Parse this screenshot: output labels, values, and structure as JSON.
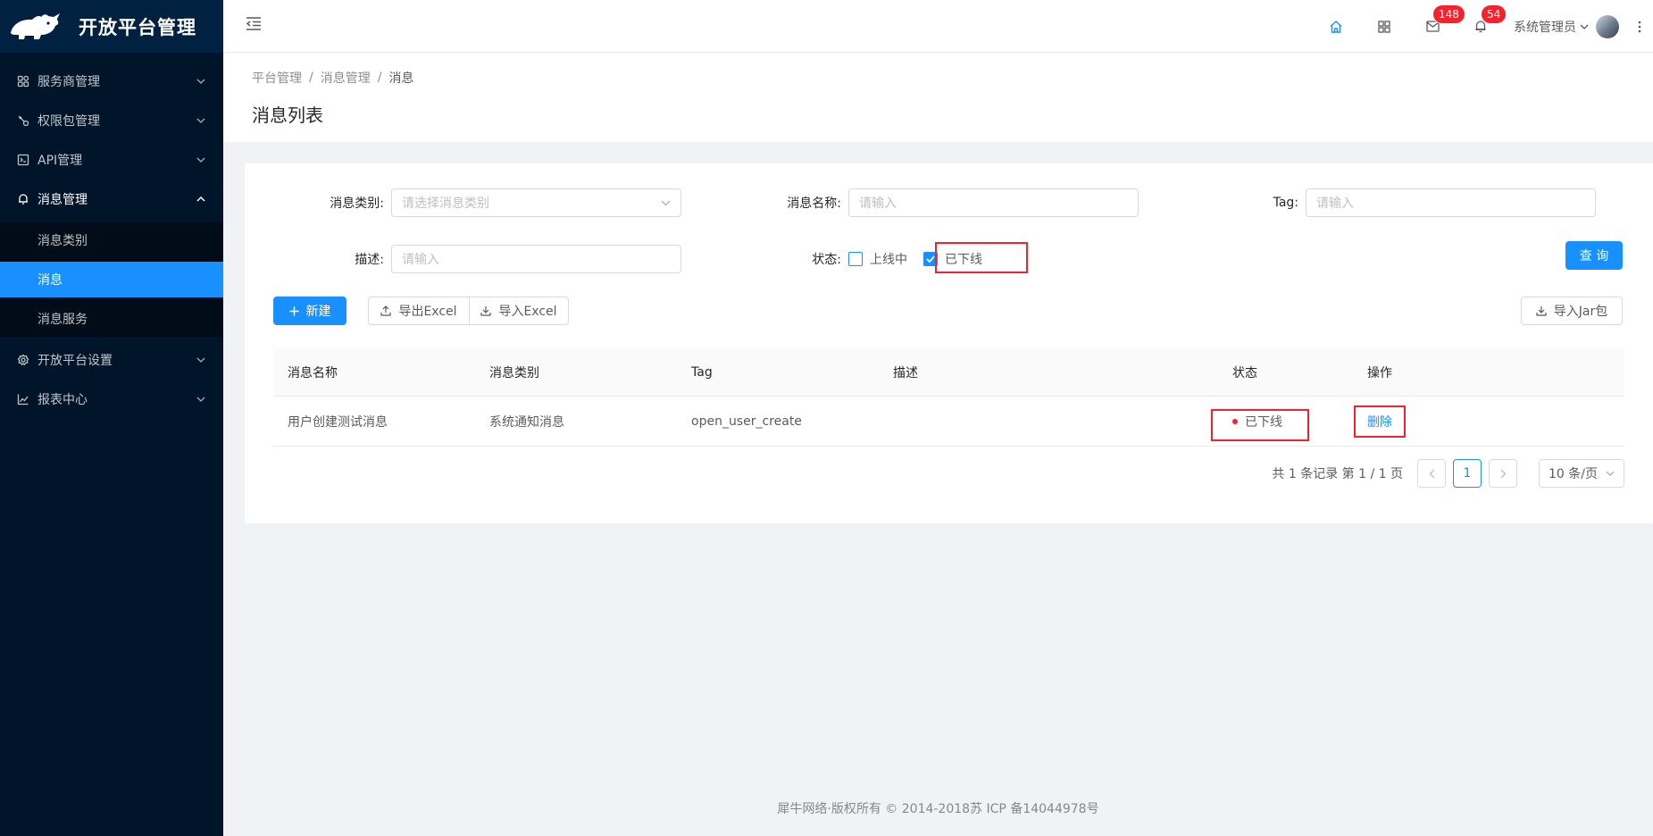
{
  "app": {
    "title": "开放平台管理"
  },
  "sidebar": {
    "items": [
      {
        "label": "服务商管理",
        "icon": "partners-icon"
      },
      {
        "label": "权限包管理",
        "icon": "permission-icon"
      },
      {
        "label": "API管理",
        "icon": "api-icon"
      },
      {
        "label": "消息管理",
        "icon": "bell-icon",
        "children": [
          "消息类别",
          "消息",
          "消息服务"
        ],
        "active_child": "消息"
      },
      {
        "label": "开放平台设置",
        "icon": "gear-icon"
      },
      {
        "label": "报表中心",
        "icon": "chart-icon"
      }
    ]
  },
  "header": {
    "mail_count": "148",
    "notice_count": "54",
    "user_name": "系统管理员"
  },
  "breadcrumb": [
    "平台管理",
    "消息管理",
    "消息"
  ],
  "page_title": "消息列表",
  "filters": {
    "category_label": "消息类别:",
    "category_placeholder": "请选择消息类别",
    "name_label": "消息名称:",
    "name_placeholder": "请输入",
    "tag_label": "Tag:",
    "tag_placeholder": "请输入",
    "desc_label": "描述:",
    "desc_placeholder": "请输入",
    "status_label": "状态:",
    "status_online": "上线中",
    "status_offline": "已下线",
    "status_online_checked": false,
    "status_offline_checked": true,
    "query_button": "查 询"
  },
  "toolbar": {
    "new_button": "新建",
    "export_button": "导出Excel",
    "import_button": "导入Excel",
    "import_jar_button": "导入Jar包"
  },
  "table": {
    "columns": [
      "消息名称",
      "消息类别",
      "Tag",
      "描述",
      "状态",
      "操作"
    ],
    "rows": [
      {
        "name": "用户创建测试消息",
        "category": "系统通知消息",
        "tag": "open_user_create",
        "desc": "",
        "status": "已下线",
        "action": "删除"
      }
    ]
  },
  "pagination": {
    "total_text": "共 1 条记录 第 1 / 1 页",
    "current_page": "1",
    "page_size": "10 条/页"
  },
  "footer": {
    "text": "犀牛网络·版权所有 © 2014-2018苏 ICP 备14044978号"
  },
  "colors": {
    "primary": "#1890ff",
    "sidebar_bg": "#001529",
    "danger": "#f5222d"
  }
}
